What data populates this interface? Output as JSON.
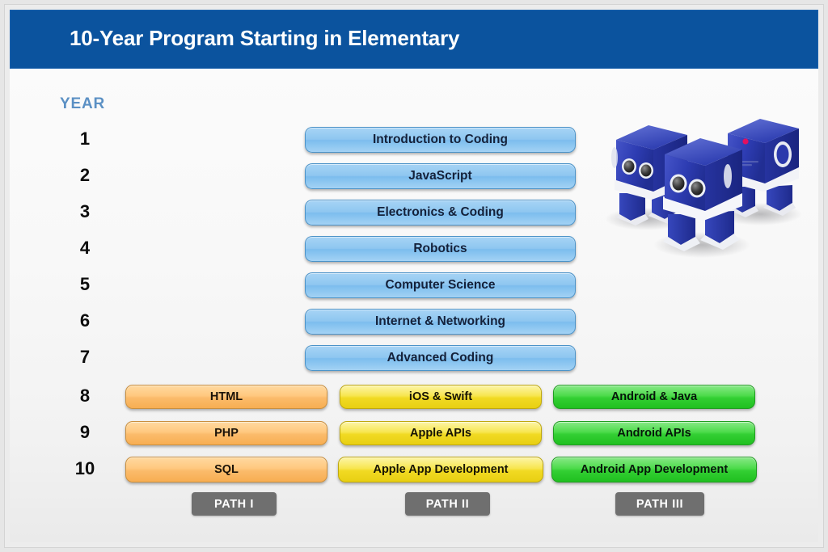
{
  "header": {
    "title": "10-Year Program Starting in Elementary"
  },
  "year_column": {
    "label": "YEAR",
    "numbers": [
      "1",
      "2",
      "3",
      "4",
      "5",
      "6",
      "7",
      "8",
      "9",
      "10"
    ]
  },
  "core_track": {
    "courses": [
      {
        "year": "1",
        "label": "Introduction to Coding"
      },
      {
        "year": "2",
        "label": "JavaScript"
      },
      {
        "year": "3",
        "label": "Electronics & Coding"
      },
      {
        "year": "4",
        "label": "Robotics"
      },
      {
        "year": "5",
        "label": "Computer Science"
      },
      {
        "year": "6",
        "label": "Internet & Networking"
      },
      {
        "year": "7",
        "label": "Advanced Coding"
      }
    ]
  },
  "paths": [
    {
      "id": "path-1",
      "tag": "PATH I",
      "color": "#f7ae52",
      "courses": [
        {
          "year": "8",
          "label": "HTML"
        },
        {
          "year": "9",
          "label": "PHP"
        },
        {
          "year": "10",
          "label": "SQL"
        }
      ]
    },
    {
      "id": "path-2",
      "tag": "PATH II",
      "color": "#f1da23",
      "courses": [
        {
          "year": "8",
          "label": "iOS & Swift"
        },
        {
          "year": "9",
          "label": "Apple APIs"
        },
        {
          "year": "10",
          "label": "Apple App Development"
        }
      ]
    },
    {
      "id": "path-3",
      "tag": "PATH III",
      "color": "#33cf33",
      "courses": [
        {
          "year": "8",
          "label": "Android & Java"
        },
        {
          "year": "9",
          "label": "Android APIs"
        },
        {
          "year": "10",
          "label": "Android App Development"
        }
      ]
    }
  ],
  "illustration": {
    "name": "three-blue-cube-robots",
    "body_color": "#2f41b8",
    "accent_color": "#ffffff",
    "indicator_color": "#e01060"
  },
  "theme": {
    "header_blue": "#0b539e",
    "year_label_blue": "#5b90c4",
    "core_bar_blue": "#8ec6f0",
    "path_tag_gray": "#6f6f6f",
    "canvas_bg": "#f8f8f8"
  }
}
